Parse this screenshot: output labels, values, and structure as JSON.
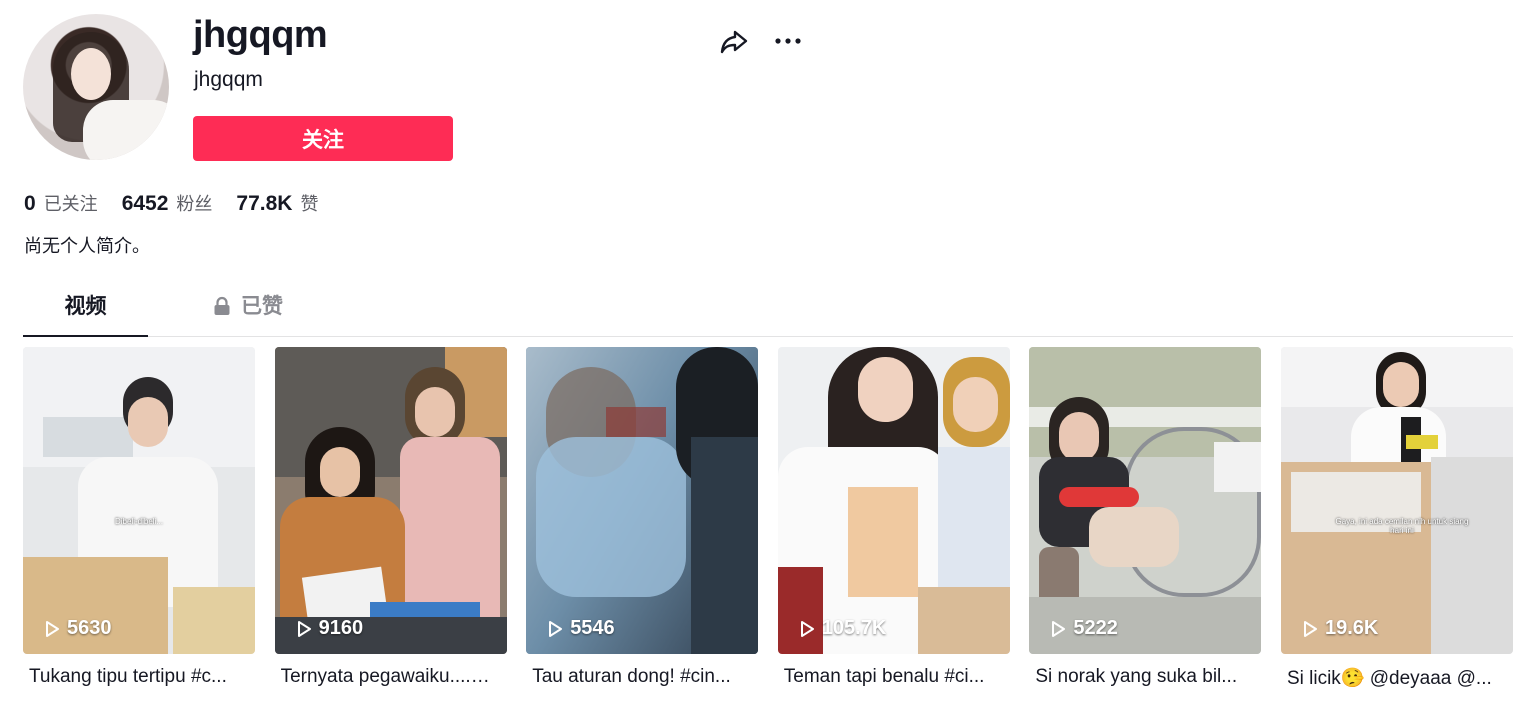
{
  "profile": {
    "username": "jhgqqm",
    "nickname": "jhgqqm",
    "follow_label": "关注",
    "bio": "尚无个人简介。"
  },
  "stats": {
    "following_count": "0",
    "following_label": "已关注",
    "followers_count": "6452",
    "followers_label": "粉丝",
    "likes_count": "77.8K",
    "likes_label": "赞"
  },
  "tabs": {
    "videos_label": "视频",
    "liked_label": "已赞"
  },
  "icons": {
    "share": "share-icon",
    "more": "more-icon",
    "lock": "lock-icon",
    "play": "play-icon"
  },
  "colors": {
    "accent": "#fe2c55",
    "text": "#161823",
    "muted": "#5e5f66"
  },
  "videos": [
    {
      "views": "5630",
      "title": "Tukang tipu tertipu #c...",
      "overlay_text": "Dibeli-dibeli..."
    },
    {
      "views": "9160",
      "title": "Ternyata pegawaiku....…",
      "overlay_text": ""
    },
    {
      "views": "5546",
      "title": "Tau aturan dong! #cin...",
      "overlay_text": ""
    },
    {
      "views": "105.7K",
      "title": "Teman tapi benalu #ci...",
      "overlay_text": ""
    },
    {
      "views": "5222",
      "title": "Si norak yang suka bil...",
      "overlay_text": ""
    },
    {
      "views": "19.6K",
      "title": "Si licik🤥 @deyaaa @...",
      "overlay_text": "Gaya, ini ada cemilan nih untuk siang hari ini"
    }
  ]
}
